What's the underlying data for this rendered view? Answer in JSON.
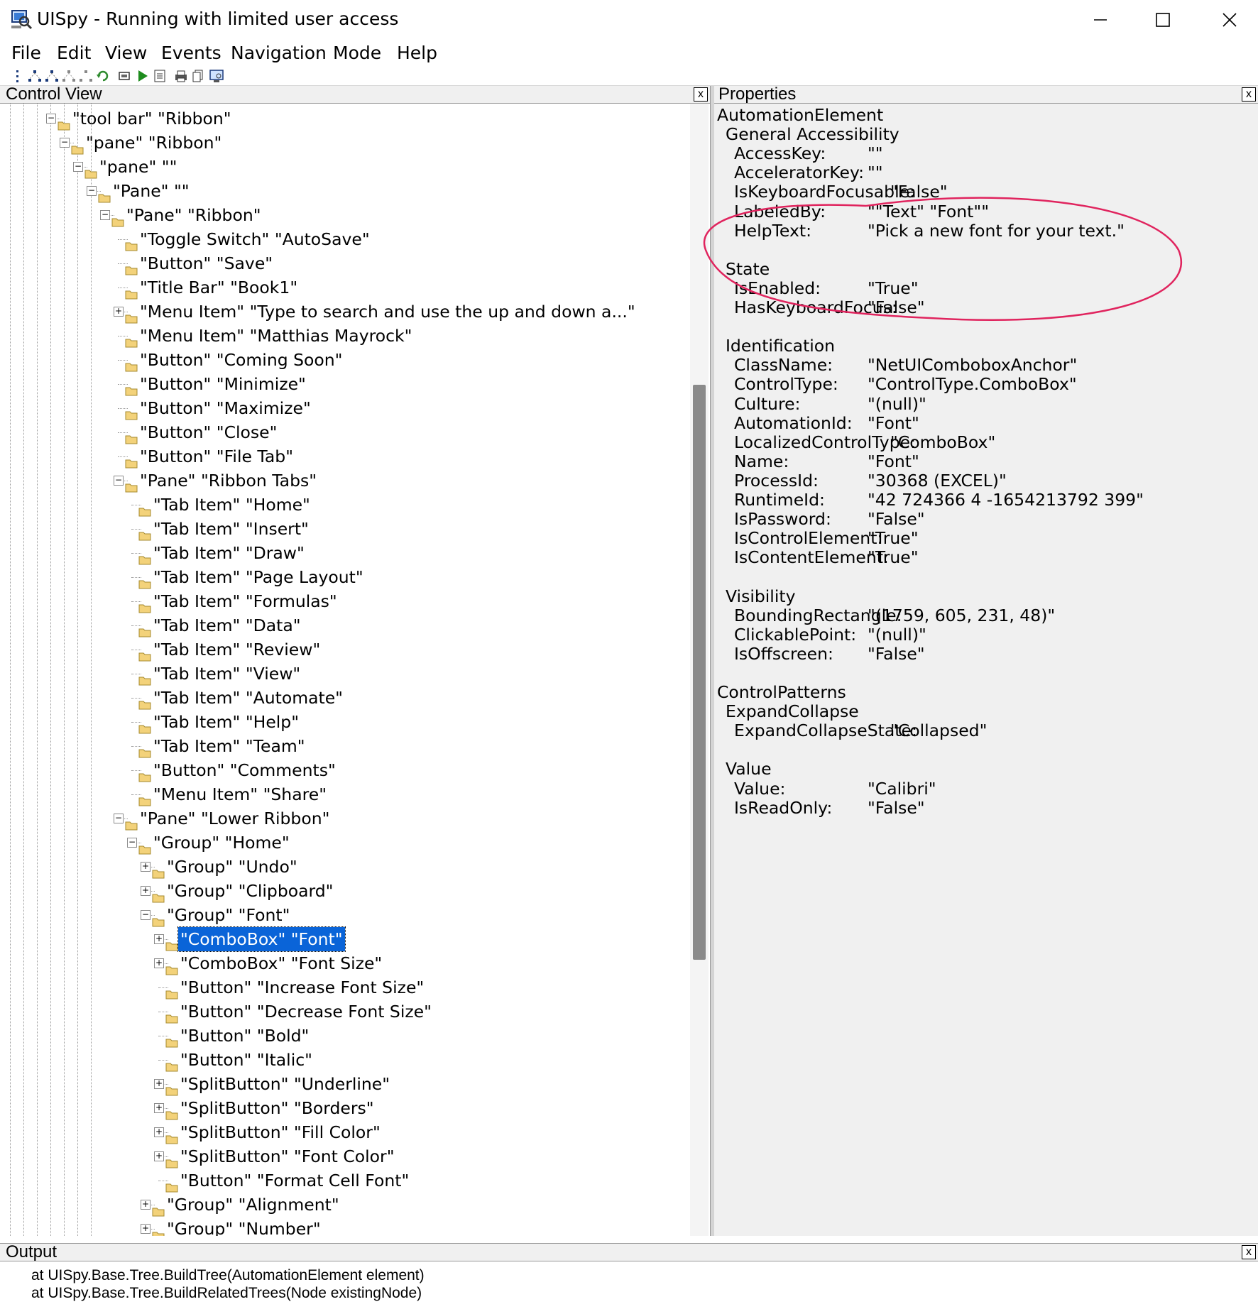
{
  "window": {
    "title": "UISpy - Running with limited user access"
  },
  "menu": [
    "File",
    "Edit",
    "View",
    "Events",
    "Navigation",
    "Mode",
    "Help"
  ],
  "toolbar": {
    "icons": [
      "tree-view-icon",
      "tree-parent-icon",
      "tree-child-icon",
      "tree-sibling-icon",
      "tree-next-icon",
      "refresh-icon",
      "highlight-icon",
      "play-icon",
      "properties-icon",
      "print-icon",
      "copy-icon",
      "screenshot-icon"
    ]
  },
  "control_view": {
    "header": "Control View",
    "close": "x",
    "nodes": [
      {
        "depth": 3,
        "expander": "minus",
        "text": "\"tool bar\" \"Ribbon\""
      },
      {
        "depth": 4,
        "expander": "minus",
        "text": "\"pane\" \"Ribbon\""
      },
      {
        "depth": 5,
        "expander": "minus",
        "text": "\"pane\" \"\""
      },
      {
        "depth": 6,
        "expander": "minus",
        "text": "\"Pane\" \"\""
      },
      {
        "depth": 7,
        "expander": "minus",
        "text": "\"Pane\" \"Ribbon\""
      },
      {
        "depth": 8,
        "expander": "",
        "text": "\"Toggle Switch\" \"AutoSave\""
      },
      {
        "depth": 8,
        "expander": "",
        "text": "\"Button\" \"Save\""
      },
      {
        "depth": 8,
        "expander": "",
        "text": "\"Title Bar\" \"Book1\""
      },
      {
        "depth": 8,
        "expander": "plus",
        "text": "\"Menu Item\" \"Type to search and use the up and down a...\""
      },
      {
        "depth": 8,
        "expander": "",
        "text": "\"Menu Item\" \"Matthias Mayrock\""
      },
      {
        "depth": 8,
        "expander": "",
        "text": "\"Button\" \"Coming Soon\""
      },
      {
        "depth": 8,
        "expander": "",
        "text": "\"Button\" \"Minimize\""
      },
      {
        "depth": 8,
        "expander": "",
        "text": "\"Button\" \"Maximize\""
      },
      {
        "depth": 8,
        "expander": "",
        "text": "\"Button\" \"Close\""
      },
      {
        "depth": 8,
        "expander": "",
        "text": "\"Button\" \"File Tab\""
      },
      {
        "depth": 8,
        "expander": "minus",
        "text": "\"Pane\" \"Ribbon Tabs\""
      },
      {
        "depth": 9,
        "expander": "",
        "text": "\"Tab Item\" \"Home\""
      },
      {
        "depth": 9,
        "expander": "",
        "text": "\"Tab Item\" \"Insert\""
      },
      {
        "depth": 9,
        "expander": "",
        "text": "\"Tab Item\" \"Draw\""
      },
      {
        "depth": 9,
        "expander": "",
        "text": "\"Tab Item\" \"Page Layout\""
      },
      {
        "depth": 9,
        "expander": "",
        "text": "\"Tab Item\" \"Formulas\""
      },
      {
        "depth": 9,
        "expander": "",
        "text": "\"Tab Item\" \"Data\""
      },
      {
        "depth": 9,
        "expander": "",
        "text": "\"Tab Item\" \"Review\""
      },
      {
        "depth": 9,
        "expander": "",
        "text": "\"Tab Item\" \"View\""
      },
      {
        "depth": 9,
        "expander": "",
        "text": "\"Tab Item\" \"Automate\""
      },
      {
        "depth": 9,
        "expander": "",
        "text": "\"Tab Item\" \"Help\""
      },
      {
        "depth": 9,
        "expander": "",
        "text": "\"Tab Item\" \"Team\""
      },
      {
        "depth": 9,
        "expander": "",
        "text": "\"Button\" \"Comments\""
      },
      {
        "depth": 9,
        "expander": "",
        "text": "\"Menu Item\" \"Share\""
      },
      {
        "depth": 8,
        "expander": "minus",
        "text": "\"Pane\" \"Lower Ribbon\""
      },
      {
        "depth": 9,
        "expander": "minus",
        "text": "\"Group\" \"Home\""
      },
      {
        "depth": 10,
        "expander": "plus",
        "text": "\"Group\" \"Undo\""
      },
      {
        "depth": 10,
        "expander": "plus",
        "text": "\"Group\" \"Clipboard\""
      },
      {
        "depth": 10,
        "expander": "minus",
        "text": "\"Group\" \"Font\""
      },
      {
        "depth": 11,
        "expander": "plus",
        "text": "\"ComboBox\" \"Font\"",
        "selected": true
      },
      {
        "depth": 11,
        "expander": "plus",
        "text": "\"ComboBox\" \"Font Size\""
      },
      {
        "depth": 11,
        "expander": "",
        "text": "\"Button\" \"Increase Font Size\""
      },
      {
        "depth": 11,
        "expander": "",
        "text": "\"Button\" \"Decrease Font Size\""
      },
      {
        "depth": 11,
        "expander": "",
        "text": "\"Button\" \"Bold\""
      },
      {
        "depth": 11,
        "expander": "",
        "text": "\"Button\" \"Italic\""
      },
      {
        "depth": 11,
        "expander": "plus",
        "text": "\"SplitButton\" \"Underline\""
      },
      {
        "depth": 11,
        "expander": "plus",
        "text": "\"SplitButton\" \"Borders\""
      },
      {
        "depth": 11,
        "expander": "plus",
        "text": "\"SplitButton\" \"Fill Color\""
      },
      {
        "depth": 11,
        "expander": "plus",
        "text": "\"SplitButton\" \"Font Color\""
      },
      {
        "depth": 11,
        "expander": "",
        "text": "\"Button\" \"Format Cell Font\""
      },
      {
        "depth": 10,
        "expander": "plus",
        "text": "\"Group\" \"Alignment\""
      },
      {
        "depth": 10,
        "expander": "plus",
        "text": "\"Group\" \"Number\""
      }
    ]
  },
  "properties": {
    "header": "Properties",
    "close": "x",
    "rows": [
      {
        "level": 0,
        "text": "AutomationElement"
      },
      {
        "level": 1,
        "text": "General Accessibility"
      },
      {
        "level": 2,
        "name": "AccessKey:",
        "value": "\"\""
      },
      {
        "level": 2,
        "name": "AcceleratorKey:",
        "value": "\"\""
      },
      {
        "level": 2,
        "name": "IsKeyboardFocusable:",
        "value": "\"False\"",
        "wide": true
      },
      {
        "level": 2,
        "name": "LabeledBy:",
        "value": "\"\"Text\" \"Font\"\""
      },
      {
        "level": 2,
        "name": "HelpText:",
        "value": "\"Pick a new font for your text.\""
      },
      {
        "level": -1
      },
      {
        "level": 1,
        "text": "State"
      },
      {
        "level": 2,
        "name": "IsEnabled:",
        "value": "\"True\""
      },
      {
        "level": 2,
        "name": "HasKeyboardFocus:",
        "value": "\"False\""
      },
      {
        "level": -1
      },
      {
        "level": 1,
        "text": "Identification"
      },
      {
        "level": 2,
        "name": "ClassName:",
        "value": "\"NetUIComboboxAnchor\""
      },
      {
        "level": 2,
        "name": "ControlType:",
        "value": "\"ControlType.ComboBox\""
      },
      {
        "level": 2,
        "name": "Culture:",
        "value": "\"(null)\""
      },
      {
        "level": 2,
        "name": "AutomationId:",
        "value": "\"Font\""
      },
      {
        "level": 2,
        "name": "LocalizedControlType:",
        "value": "\"ComboBox\"",
        "wide": true
      },
      {
        "level": 2,
        "name": "Name:",
        "value": "\"Font\""
      },
      {
        "level": 2,
        "name": "ProcessId:",
        "value": "\"30368 (EXCEL)\""
      },
      {
        "level": 2,
        "name": "RuntimeId:",
        "value": "\"42 724366 4 -1654213792 399\""
      },
      {
        "level": 2,
        "name": "IsPassword:",
        "value": "\"False\""
      },
      {
        "level": 2,
        "name": "IsControlElement:",
        "value": "\"True\""
      },
      {
        "level": 2,
        "name": "IsContentElement:",
        "value": "\"True\""
      },
      {
        "level": -1
      },
      {
        "level": 1,
        "text": "Visibility"
      },
      {
        "level": 2,
        "name": "BoundingRectangle:",
        "value": "\"(1759, 605, 231, 48)\"",
        "tight": true
      },
      {
        "level": 2,
        "name": "ClickablePoint:",
        "value": "\"(null)\""
      },
      {
        "level": 2,
        "name": "IsOffscreen:",
        "value": "\"False\""
      },
      {
        "level": -1
      },
      {
        "level": 0,
        "text": "ControlPatterns"
      },
      {
        "level": 1,
        "text": "ExpandCollapse"
      },
      {
        "level": 2,
        "name": "ExpandCollapseState:",
        "value": "\"Collapsed\"",
        "wide": true
      },
      {
        "level": -1
      },
      {
        "level": 1,
        "text": "Value"
      },
      {
        "level": 2,
        "name": "Value:",
        "value": "\"Calibri\""
      },
      {
        "level": 2,
        "name": "IsReadOnly:",
        "value": "\"False\""
      }
    ],
    "annotation_color": "#e0245e"
  },
  "output": {
    "header": "Output",
    "close": "x",
    "lines": [
      "at UISpy.Base.Tree.BuildTree(AutomationElement element)",
      "at UISpy.Base.Tree.BuildRelatedTrees(Node existingNode)"
    ]
  },
  "colors": {
    "selection": "#0a64d8",
    "folder": "#f3d27a",
    "panel_bg": "#f0f0f0"
  }
}
